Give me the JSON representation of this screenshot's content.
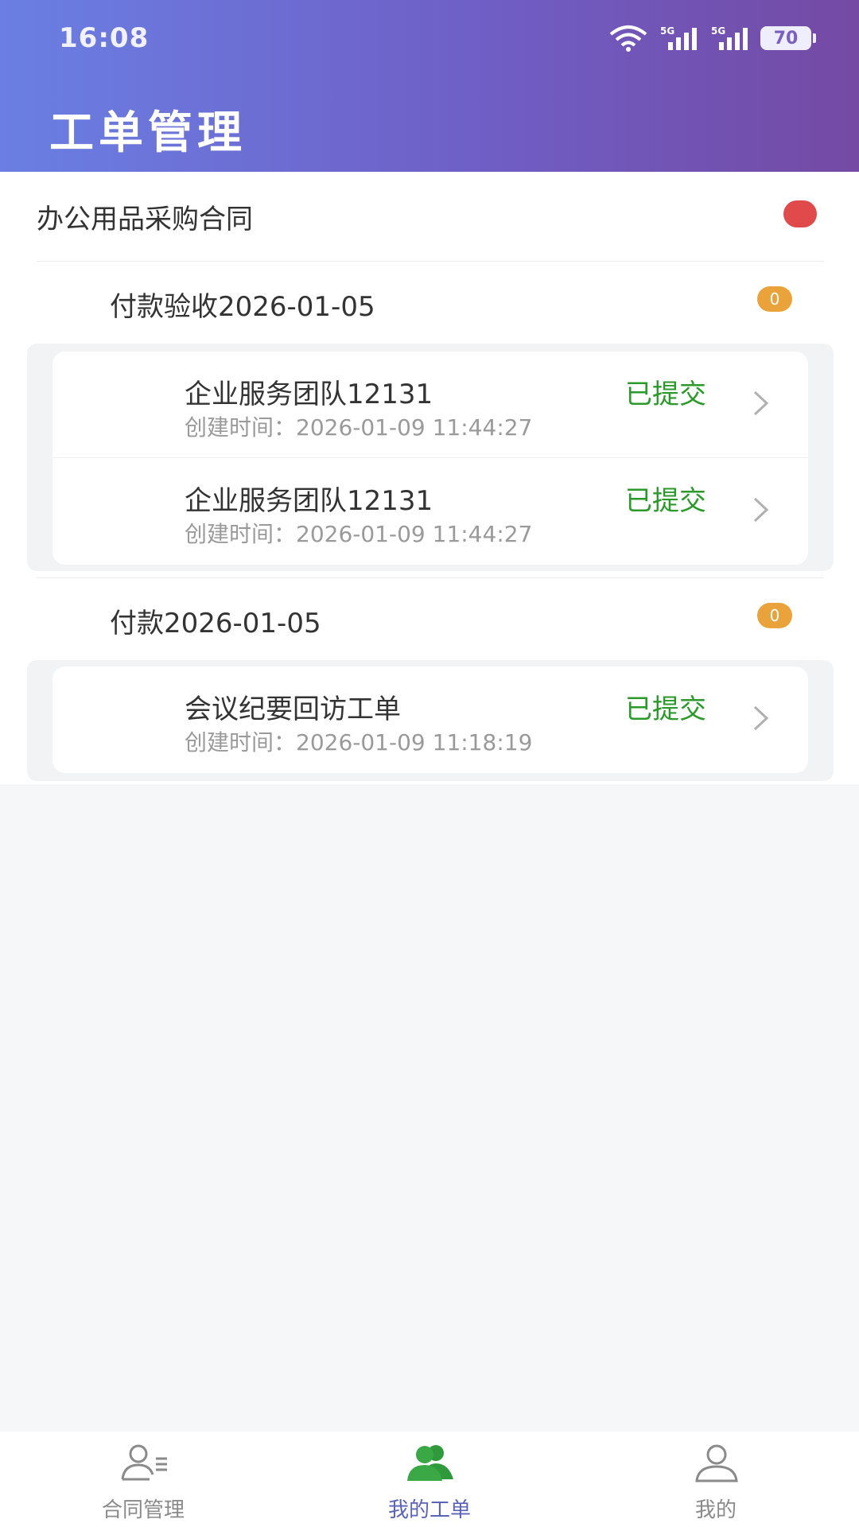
{
  "status_bar": {
    "time": "16:08",
    "network_1": "5G",
    "network_2": "5G",
    "battery": "70"
  },
  "header": {
    "title": "工单管理"
  },
  "contract": {
    "title": "办公用品采购合同",
    "indicator_color": "#e04a4a"
  },
  "groups": [
    {
      "title": "付款验收2026-01-05",
      "count": "0",
      "items": [
        {
          "title": "企业服务团队12131",
          "time": "创建时间：2026-01-09 11:44:27",
          "status": "已提交"
        },
        {
          "title": "企业服务团队12131",
          "time": "创建时间：2026-01-09 11:44:27",
          "status": "已提交"
        }
      ]
    },
    {
      "title": "付款2026-01-05",
      "count": "0",
      "items": [
        {
          "title": "会议纪要回访工单",
          "time": "创建时间：2026-01-09 11:18:19",
          "status": "已提交"
        }
      ]
    }
  ],
  "bottom_nav": [
    {
      "label": "合同管理",
      "icon": "contract-user-icon",
      "active": false
    },
    {
      "label": "我的工单",
      "icon": "team-icon",
      "active": true
    },
    {
      "label": "我的",
      "icon": "user-icon",
      "active": false
    }
  ],
  "colors": {
    "status_green": "#2b9a2b",
    "badge_orange": "#eaa33a",
    "active_nav": "#5b63b7",
    "header_gradient_start": "#6a7fe3",
    "header_gradient_end": "#744aa4"
  }
}
